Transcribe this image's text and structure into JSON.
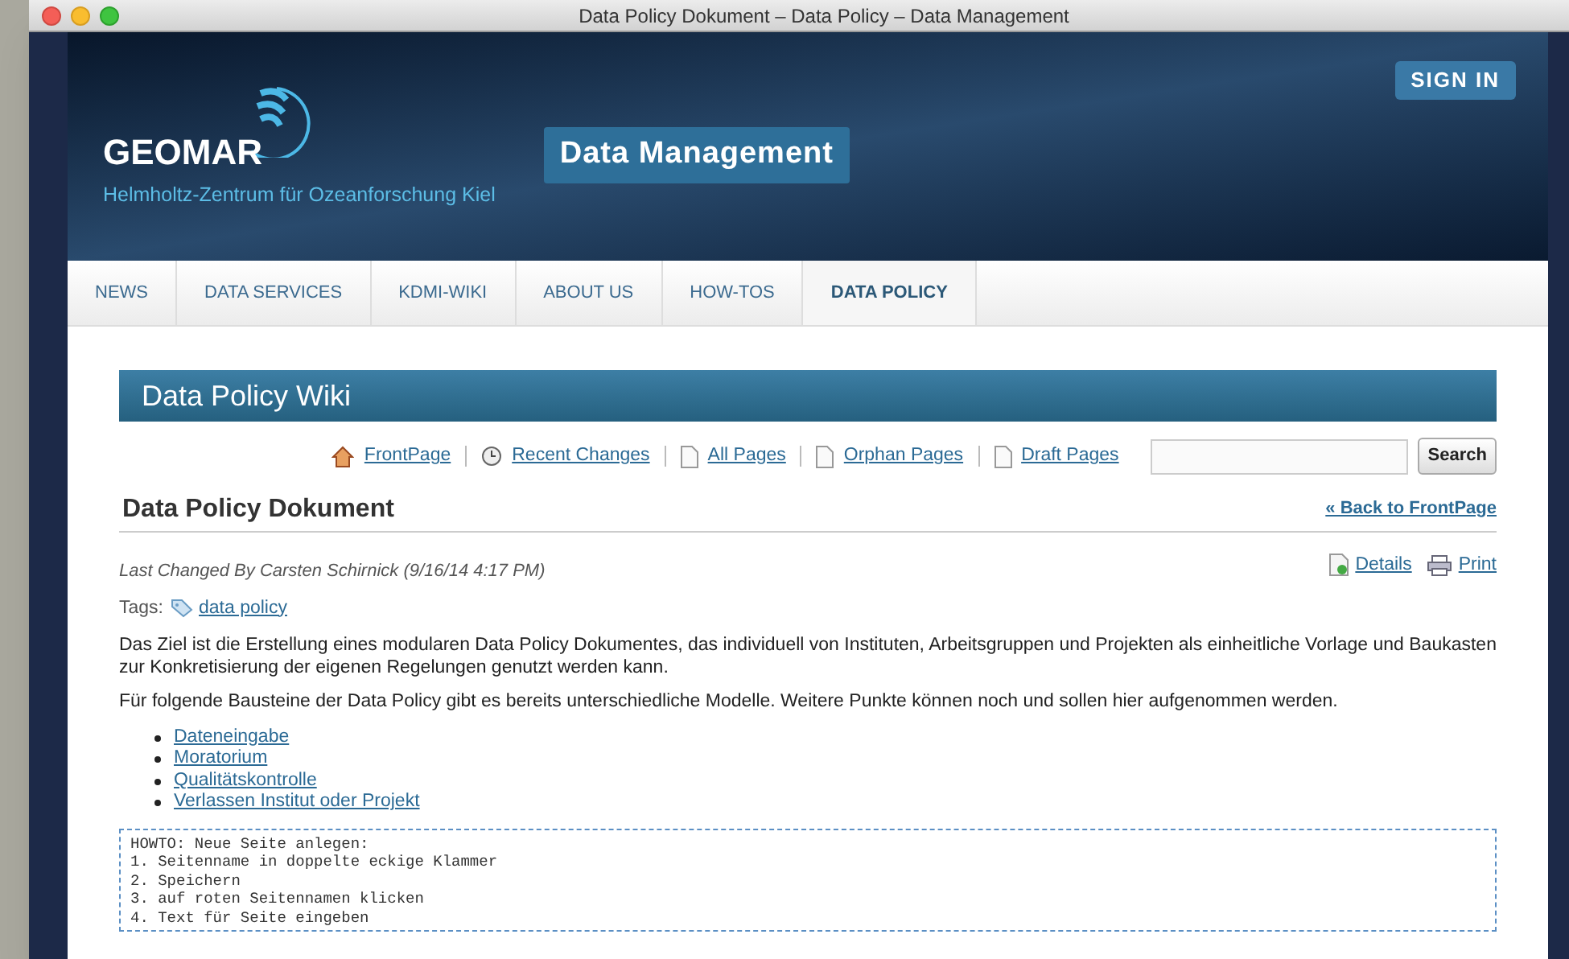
{
  "window": {
    "title": "Data Policy Dokument – Data Policy – Data Management"
  },
  "header": {
    "logo": "GEOMAR",
    "subtitle": "Helmholtz-Zentrum für Ozeanforschung Kiel",
    "banner": "Data Management",
    "sign_in": "SIGN IN"
  },
  "nav": [
    {
      "label": "NEWS",
      "selected": false
    },
    {
      "label": "DATA SERVICES",
      "selected": false
    },
    {
      "label": "KDMI-WIKI",
      "selected": false
    },
    {
      "label": "ABOUT US",
      "selected": false
    },
    {
      "label": "HOW-TOS",
      "selected": false
    },
    {
      "label": "DATA POLICY",
      "selected": true
    }
  ],
  "wiki": {
    "title": "Data Policy Wiki",
    "links": [
      {
        "kind": "home",
        "label": "FrontPage"
      },
      {
        "kind": "clock",
        "label": "Recent Changes"
      },
      {
        "kind": "page",
        "label": "All Pages"
      },
      {
        "kind": "page",
        "label": "Orphan Pages"
      },
      {
        "kind": "page",
        "label": "Draft Pages"
      }
    ],
    "search_button": "Search"
  },
  "page": {
    "title": "Data Policy Dokument",
    "back_link": "« Back to FrontPage",
    "last_changed": "Last Changed By Carsten Schirnick (9/16/14 4:17 PM)",
    "details": "Details",
    "print": "Print",
    "tags_label": "Tags:",
    "tag": "data policy",
    "paragraphs": [
      "Das Ziel ist die Erstellung eines modularen Data Policy Dokumentes, das individuell von Instituten, Arbeitsgruppen und Projekten als einheitliche Vorlage und Baukasten zur Konkretisierung der eigenen Regelungen genutzt werden kann.",
      "Für folgende Bausteine der Data Policy gibt es bereits unterschiedliche Modelle. Weitere Punkte können noch und sollen hier aufgenommen werden."
    ],
    "list": [
      "Dateneingabe",
      "Moratorium",
      "Qualitätskontrolle",
      "Verlassen Institut oder Projekt"
    ],
    "howto": [
      "HOWTO: Neue Seite anlegen:",
      "1. Seitenname in doppelte eckige Klammer",
      "2. Speichern",
      "3. auf roten Seitennamen klicken",
      "4. Text für Seite eingeben"
    ]
  }
}
